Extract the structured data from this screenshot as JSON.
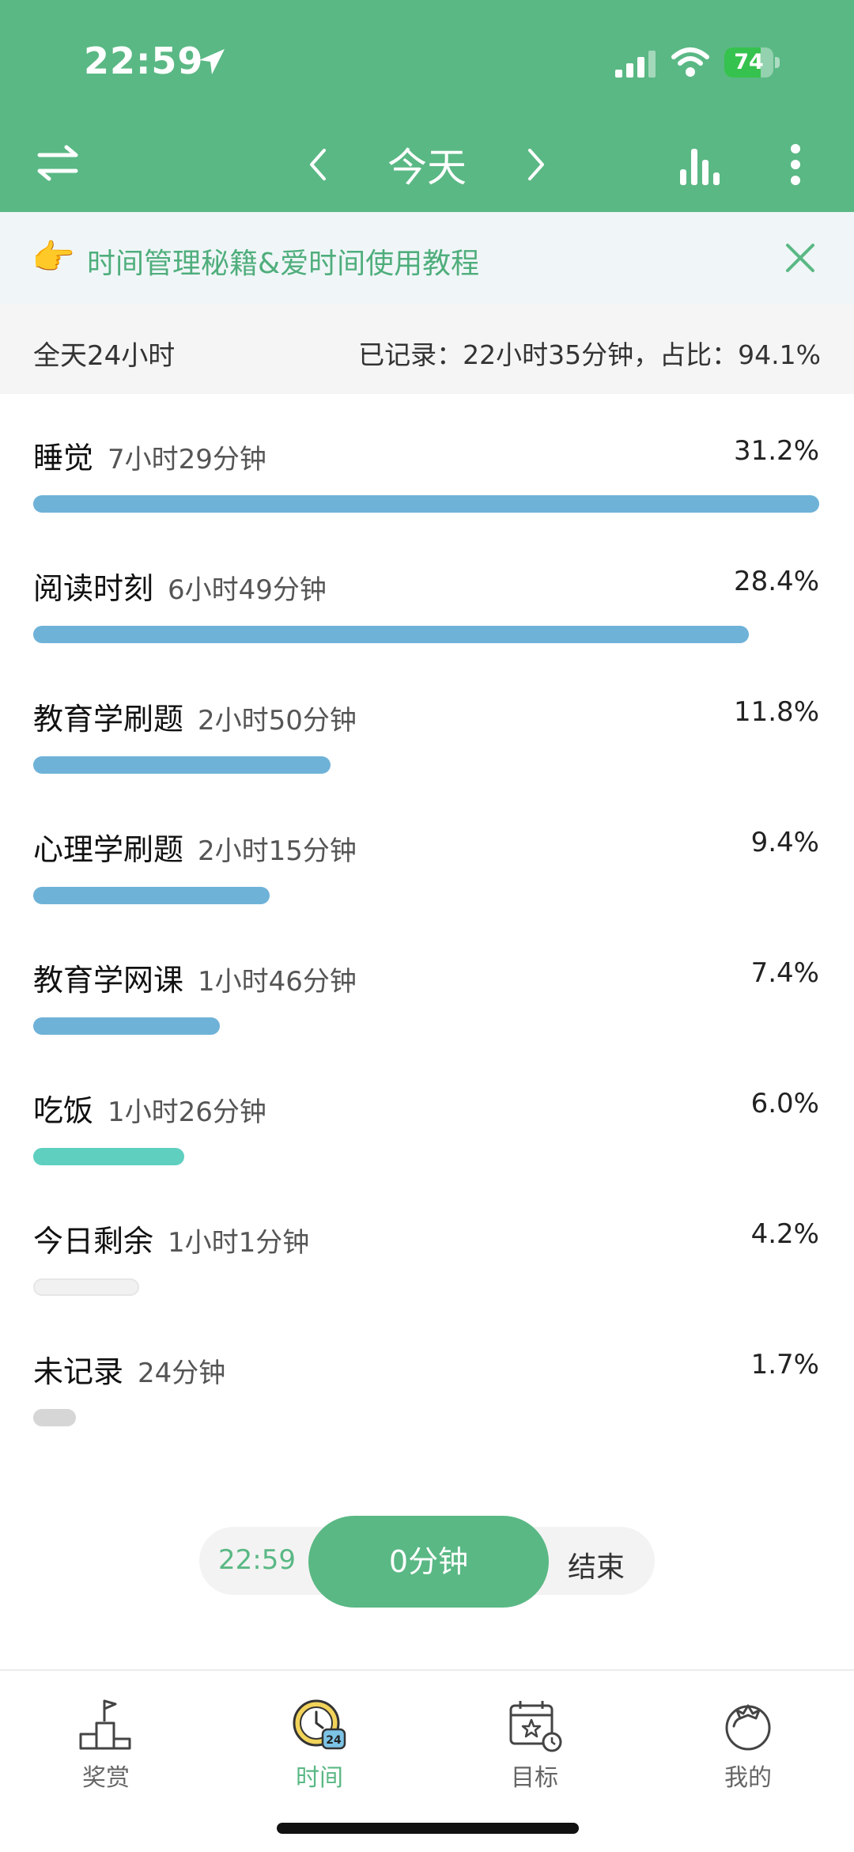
{
  "status_bar": {
    "time": "22:59",
    "battery": "74",
    "battery_level": 0.74
  },
  "header": {
    "title": "今天"
  },
  "banner": {
    "emoji": "👉",
    "text": "时间管理秘籍&爱时间使用教程"
  },
  "summary": {
    "total": "全天24小时",
    "recorded": "已记录：22小时35分钟，占比：94.1%"
  },
  "items": [
    {
      "name": "睡觉",
      "duration": "7小时29分钟",
      "percent": "31.2%",
      "share": 0.312,
      "color": "#6fb2d8"
    },
    {
      "name": "阅读时刻",
      "duration": "6小时49分钟",
      "percent": "28.4%",
      "share": 0.284,
      "color": "#6fb2d8"
    },
    {
      "name": "教育学刷题",
      "duration": "2小时50分钟",
      "percent": "11.8%",
      "share": 0.118,
      "color": "#6fb2d8"
    },
    {
      "name": "心理学刷题",
      "duration": "2小时15分钟",
      "percent": "9.4%",
      "share": 0.094,
      "color": "#6fb2d8"
    },
    {
      "name": "教育学网课",
      "duration": "1小时46分钟",
      "percent": "7.4%",
      "share": 0.074,
      "color": "#6fb2d8"
    },
    {
      "name": "吃饭",
      "duration": "1小时26分钟",
      "percent": "6.0%",
      "share": 0.06,
      "color": "#5fcfc0"
    },
    {
      "name": "今日剩余",
      "duration": "1小时1分钟",
      "percent": "4.2%",
      "share": 0.042,
      "color": "#f1f1f1"
    },
    {
      "name": "未记录",
      "duration": "24分钟",
      "percent": "1.7%",
      "share": 0.017,
      "color": "#d6d6d6"
    }
  ],
  "timer": {
    "start": "22:59",
    "elapsed": "0分钟",
    "end_label": "结束"
  },
  "tabs": [
    {
      "label": "奖赏",
      "icon": "flag-podium-icon"
    },
    {
      "label": "时间",
      "icon": "clock-24-icon"
    },
    {
      "label": "目标",
      "icon": "calendar-star-icon"
    },
    {
      "label": "我的",
      "icon": "tomato-icon"
    }
  ],
  "colors": {
    "primary": "#5ab884",
    "bar_blue": "#6fb2d8",
    "bar_teal": "#5fcfc0"
  }
}
